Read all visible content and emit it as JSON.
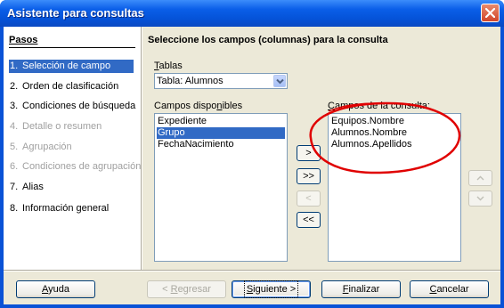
{
  "window": {
    "title": "Asistente para consultas",
    "colors": {
      "titlebar": "#0a5ee8",
      "face": "#ece9d8",
      "selection": "#316ac5",
      "highlight_ring": "#e00000"
    }
  },
  "steps": {
    "title": "Pasos",
    "items": [
      {
        "num": "1.",
        "label": "Selección de campo",
        "state": "active"
      },
      {
        "num": "2.",
        "label": "Orden de clasificación",
        "state": "enabled"
      },
      {
        "num": "3.",
        "label": "Condiciones de búsqueda",
        "state": "enabled"
      },
      {
        "num": "4.",
        "label": "Detalle o resumen",
        "state": "disabled"
      },
      {
        "num": "5.",
        "label": "Agrupación",
        "state": "disabled"
      },
      {
        "num": "6.",
        "label": "Condiciones de agrupación",
        "state": "disabled"
      },
      {
        "num": "7.",
        "label": "Alias",
        "state": "enabled"
      },
      {
        "num": "8.",
        "label": "Información general",
        "state": "enabled"
      }
    ]
  },
  "main": {
    "heading": "Seleccione los campos (columnas) para la consulta",
    "tables_label": {
      "pre": "",
      "accel": "T",
      "post": "ablas"
    },
    "tables_combo_value": "Tabla: Alumnos",
    "available_label": {
      "pre": "Campos dispo",
      "accel": "n",
      "post": "ibles"
    },
    "available_fields": [
      {
        "label": "Expediente",
        "selected": false
      },
      {
        "label": "Grupo",
        "selected": true
      },
      {
        "label": "FechaNacimiento",
        "selected": false
      }
    ],
    "query_label": {
      "pre": "",
      "accel": "C",
      "post": "ampos de la consulta:"
    },
    "query_fields": [
      {
        "label": "Equipos.Nombre"
      },
      {
        "label": "Alumnos.Nombre"
      },
      {
        "label": "Alumnos.Apellidos"
      }
    ],
    "move_buttons": [
      {
        "label": ">",
        "enabled": true
      },
      {
        "label": ">>",
        "enabled": true
      },
      {
        "label": "<",
        "enabled": false
      },
      {
        "label": "<<",
        "enabled": true
      }
    ],
    "order_buttons": [
      {
        "icon": "arrow-up-icon",
        "enabled": false
      },
      {
        "icon": "arrow-down-icon",
        "enabled": false
      }
    ]
  },
  "footer": {
    "help": {
      "accel": "A",
      "post": "yuda"
    },
    "back": {
      "pre": "< ",
      "accel": "R",
      "post": "egresar",
      "enabled": false
    },
    "next": {
      "pre": "",
      "accel": "S",
      "post": "iguiente >"
    },
    "finish": {
      "accel": "F",
      "post": "inalizar"
    },
    "cancel": {
      "accel": "C",
      "post": "ancelar"
    }
  }
}
